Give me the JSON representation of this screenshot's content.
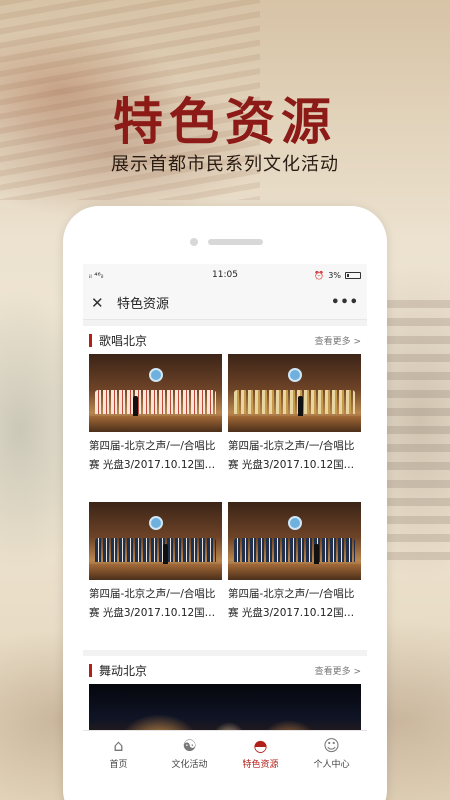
{
  "promo": {
    "headline": "特色资源",
    "subline": "展示首都市民系列文化活动"
  },
  "statusbar": {
    "left": "ᵢₗ ⁴⁶ᵢₗ",
    "time": "11:05",
    "battery": "3%"
  },
  "navbar": {
    "close_icon": "close-icon",
    "title": "特色资源",
    "more": "•••"
  },
  "sections": [
    {
      "title": "歌唱北京",
      "more": "查看更多 >",
      "items": [
        {
          "text": "第四届-北京之声/一/合唱比赛 光盘3/2017.10.12国…",
          "thumb": "choir-red"
        },
        {
          "text": "第四届-北京之声/一/合唱比赛 光盘3/2017.10.12国…",
          "thumb": "choir-gold"
        },
        {
          "text": "第四届-北京之声/一/合唱比赛 光盘3/2017.10.12国…",
          "thumb": "choir-blue"
        },
        {
          "text": "第四届-北京之声/一/合唱比赛 光盘3/2017.10.12国…",
          "thumb": "choir-blue"
        }
      ]
    },
    {
      "title": "舞动北京",
      "more": "查看更多 >"
    }
  ],
  "tabbar": [
    {
      "label": "首页",
      "icon": "home-icon",
      "active": false
    },
    {
      "label": "文化活动",
      "icon": "activity-icon",
      "active": false
    },
    {
      "label": "特色资源",
      "icon": "fan-icon",
      "active": true
    },
    {
      "label": "个人中心",
      "icon": "user-icon",
      "active": false
    }
  ],
  "colors": {
    "accent": "#b1201a",
    "headline": "#8c1a16"
  }
}
